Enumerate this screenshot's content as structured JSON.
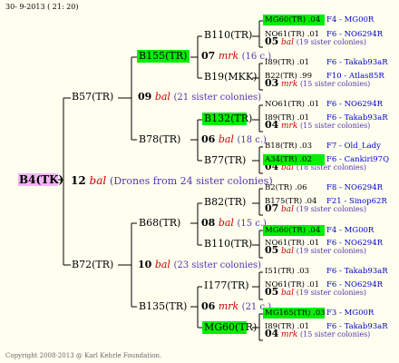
{
  "header": "30- 9-2013 ( 21: 20)",
  "footer": "Copyright 2008-2013 @ Karl Kehrle Foundation.",
  "watermark": "Karl Kehrle Foundation",
  "root": {
    "name": "B4(TK)",
    "num": "12",
    "tag": "bal",
    "note": "(Drones from 24 sister colonies)"
  },
  "g1": [
    {
      "name": "B57(TR)",
      "num": "09",
      "tag": "bal",
      "note": "(21 sister colonies)"
    },
    {
      "name": "B72(TR)",
      "num": "10",
      "tag": "bal",
      "note": "(23 sister colonies)"
    }
  ],
  "g2": [
    {
      "name": "B155(TR)",
      "num": "07",
      "tag": "mrk",
      "note": "(16 c.)"
    },
    {
      "name": "B78(TR)",
      "num": "06",
      "tag": "bal",
      "note": "(18 c.)"
    },
    {
      "name": "B68(TR)",
      "num": "08",
      "tag": "bal",
      "note": "(15 c.)"
    },
    {
      "name": "B135(TR)",
      "num": "06",
      "tag": "mrk",
      "note": "(21 c.)"
    }
  ],
  "g3": [
    {
      "name": "B110(TR)",
      "num": "05",
      "tag": "bal",
      "note": "(19 sister colonies)"
    },
    {
      "name": "B19(MKK)",
      "num": "03",
      "tag": "mrk",
      "note": "(15 sister colonies)"
    },
    {
      "name": "B132(TR)",
      "num": "04",
      "tag": "mrk",
      "note": "(15 sister colonies)"
    },
    {
      "name": "B77(TR)",
      "num": "04",
      "tag": "bal",
      "note": "(18 sister colonies)"
    },
    {
      "name": "B82(TR)",
      "num": "07",
      "tag": "bal",
      "note": "(19 sister colonies)"
    },
    {
      "name": "B110(TR)",
      "num": "05",
      "tag": "bal",
      "note": "(19 sister colonies)"
    },
    {
      "name": "I177(TR)",
      "num": "05",
      "tag": "bal",
      "note": "(19 sister colonies)"
    },
    {
      "name": "MG60(TR)",
      "num": "04",
      "tag": "mrk",
      "note": "(15 sister colonies)"
    }
  ],
  "g4": [
    {
      "name": "MG60(TR) .04",
      "ref": "F4 - MG00R"
    },
    {
      "name": "NO61(TR) .01",
      "ref": "F6 - NO6294R"
    },
    {
      "name": "I89(TR) .01",
      "ref": "F6 - Takab93aR"
    },
    {
      "name": "B22(TR) .99",
      "ref": "F10 - Atlas85R"
    },
    {
      "name": "NO61(TR) .01",
      "ref": "F6 - NO6294R"
    },
    {
      "name": "I89(TR) .01",
      "ref": "F6 - Takab93aR"
    },
    {
      "name": "B18(TR) .03",
      "ref": "F7 - Old_Lady"
    },
    {
      "name": "A34(TR) .02",
      "ref": "F6 - Cankiri97Q"
    },
    {
      "name": "B2(TR) .06",
      "ref": "F8 - NO6294R"
    },
    {
      "name": "B175(TR) .04",
      "ref": "F21 - Sinop62R"
    },
    {
      "name": "MG60(TR) .04",
      "ref": "F4 - MG00R"
    },
    {
      "name": "NO61(TR) .01",
      "ref": "F6 - NO6294R"
    },
    {
      "name": "I51(TR) .03",
      "ref": "F6 - Takab93aR"
    },
    {
      "name": "NO61(TR) .01",
      "ref": "F6 - NO6294R"
    },
    {
      "name": "MG165(TR) .03",
      "ref": "F3 - MG00R"
    },
    {
      "name": "I89(TR) .01",
      "ref": "F6 - Takab93aR"
    }
  ]
}
